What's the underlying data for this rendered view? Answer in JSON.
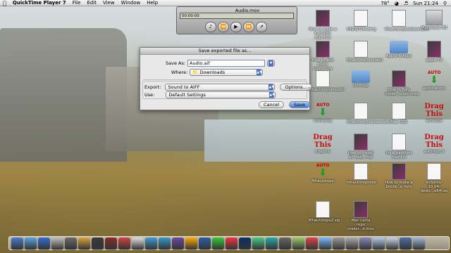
{
  "menubar": {
    "app_name": "QuickTime Player 7",
    "items": [
      "File",
      "Edit",
      "View",
      "Window",
      "Help"
    ],
    "temperature": "78°",
    "clock": "Sun 21:24"
  },
  "qt_player": {
    "title": "Audio.mov",
    "time": "00:00:00"
  },
  "dialog": {
    "title": "Save exported file as...",
    "save_as_label": "Save As:",
    "save_as_value": "Audio.aif",
    "where_label": "Where:",
    "where_value": "Downloads",
    "export_label": "Export:",
    "export_value": "Sound to AIFF",
    "options_label": "Options...",
    "use_label": "Use:",
    "use_value": "Default Settings",
    "cancel_label": "Cancel",
    "save_label": "Save"
  },
  "desktop_icons": [
    {
      "label": "How to make a bootable usb.mov",
      "kind": "video"
    },
    {
      "label": "KINGSTON.dmg",
      "kind": "file"
    },
    {
      "label": "Mhautorepodebsanable",
      "kind": "file"
    },
    {
      "label": "Macintosh HD",
      "kind": "drive"
    },
    {
      "label": "How to add multi-repos.mov",
      "kind": "video"
    },
    {
      "label": "Mhautorepoinstalld",
      "kind": "file"
    },
    {
      "label": "AppleFarApps",
      "kind": "folder"
    },
    {
      "label": "apple TV",
      "kind": "video"
    },
    {
      "label": "Mhautorepoinstalld",
      "kind": "file"
    },
    {
      "label": "Desktop",
      "kind": "folder"
    },
    {
      "label": "How to fully install...exom.mov",
      "kind": "video"
    },
    {
      "label": "applications",
      "kind": "arrow",
      "art": "AUTO"
    },
    {
      "label": "Icons.png",
      "kind": "arrow",
      "art": "AUTO"
    },
    {
      "label": "Mhautorepodebsanable",
      "kind": "file"
    },
    {
      "label": "Mac USB",
      "kind": "file"
    },
    {
      "label": "autorepo",
      "kind": "drag",
      "art": "Drag This"
    },
    {
      "label": "dragthis",
      "kind": "drag",
      "art": "Drag This"
    },
    {
      "label": "How to install all .deb...nov",
      "kind": "video"
    },
    {
      "label": "linux partition mac.txt",
      "kind": "file"
    },
    {
      "label": "autorepo 2",
      "kind": "drag",
      "art": "Drag This"
    },
    {
      "label": "Mhautorepo",
      "kind": "arrow",
      "art": "AUTO"
    },
    {
      "label": "mhautorepodeb",
      "kind": "file"
    },
    {
      "label": "How to make a boota...e.mov",
      "kind": "video"
    },
    {
      "label": "xubuntu-10.04-deskt...d64.iso",
      "kind": "file"
    },
    {
      "label": "Mhautorepo2.zip",
      "kind": "file"
    },
    {
      "label": "Mac cydia repo maker...d.mov",
      "kind": "video"
    }
  ],
  "dock_colors": [
    "#4a7bd1",
    "#5aa4e0",
    "#2f6fd6",
    "#c0c0c0",
    "#6a6a6a",
    "#d9a33b",
    "#3a3a3a",
    "#8b2b2b",
    "#c44",
    "#e0e0e0",
    "#3d9bd9",
    "#39c",
    "#6b4aa5",
    "#fa0",
    "#2b5ea9",
    "#3c3",
    "#e34",
    "#0b2f6a",
    "#4c8",
    "#2aa",
    "#666",
    "#9c6",
    "#d44",
    "#7bf",
    "#999",
    "#aaa",
    "#88b",
    "#b5c9e8",
    "#c9d4e6",
    "#4d6fa8",
    "#a0b8d8"
  ]
}
